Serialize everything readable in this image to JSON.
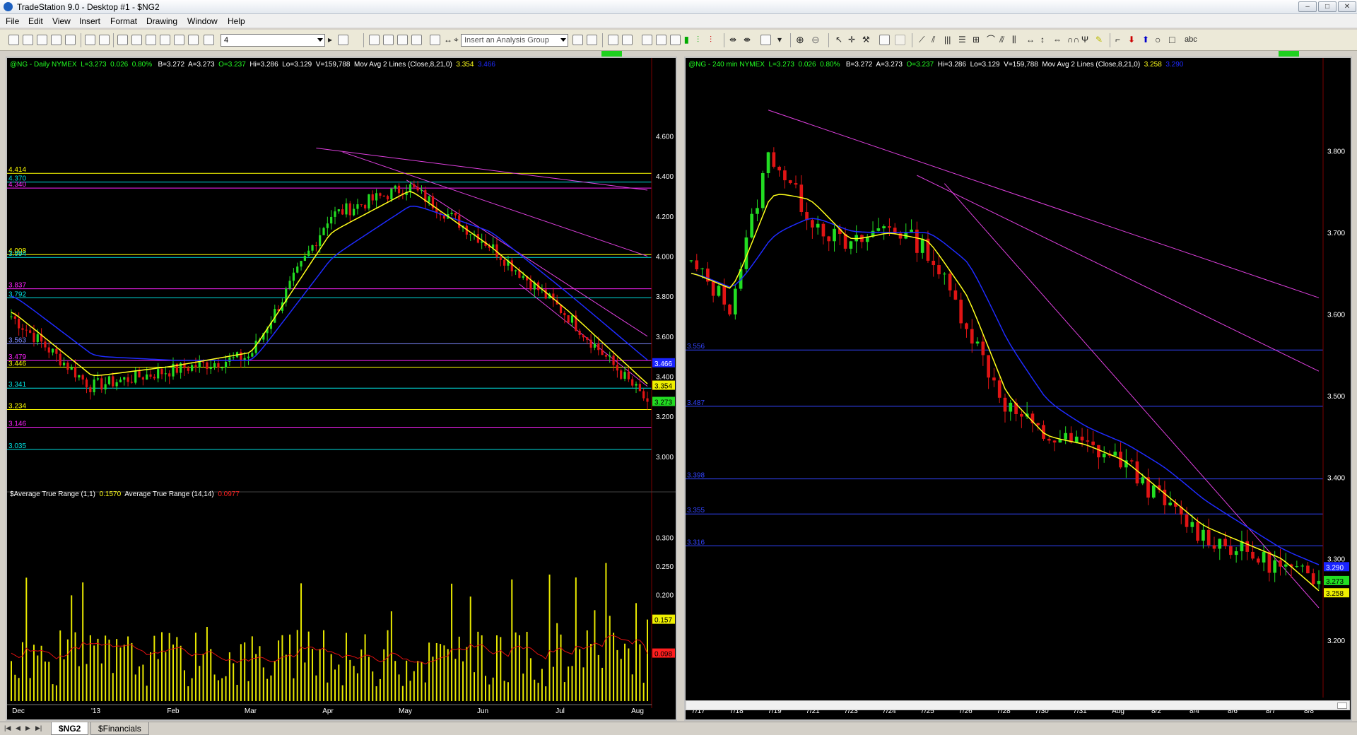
{
  "window": {
    "title": "TradeStation 9.0 - Desktop #1 - $NG2",
    "min": "–",
    "max": "□",
    "close": "✕"
  },
  "menu": [
    "File",
    "Edit",
    "View",
    "Insert",
    "Format",
    "Drawing",
    "Window",
    "Help"
  ],
  "toolbar": {
    "interval_value": "4",
    "analysis_group_placeholder": "Insert an Analysis Group",
    "text_tool": "abc"
  },
  "charts": [
    {
      "id": "daily",
      "header": {
        "symbol": "@NG - Daily  NYMEX",
        "last": "L=3.273",
        "chg": "0.026",
        "pct": "0.80%",
        "bid": "B=3.272",
        "ask": "A=3.273",
        "open": "O=3.237",
        "high": "Hi=3.286",
        "low": "Lo=3.129",
        "vol": "V=159,788",
        "study": "Mov Avg 2 Lines (Close,8,21,0)",
        "ma_fast": "3.354",
        "ma_slow": "3.466"
      },
      "price_axis": {
        "ticks": [
          "4.600",
          "4.400",
          "4.200",
          "4.000",
          "3.800",
          "3.600",
          "3.400",
          "3.200",
          "3.000"
        ],
        "range": [
          2.83,
          4.75
        ]
      },
      "price_markers": [
        {
          "label": "3.466",
          "color": "#1a24ff"
        },
        {
          "label": "3.354",
          "color": "#f0f000"
        },
        {
          "label": "3.273",
          "color": "#22dd22"
        }
      ],
      "levels": [
        {
          "label": "4.414",
          "color": "#ffff00"
        },
        {
          "label": "4.370",
          "color": "#00e0e0"
        },
        {
          "label": "4.340",
          "color": "#ff22ff"
        },
        {
          "label": "4.008",
          "color": "#ffff00"
        },
        {
          "label": "3.994",
          "color": "#00e0e0"
        },
        {
          "label": "3.837",
          "color": "#ff22ff"
        },
        {
          "label": "3.792",
          "color": "#00e0e0"
        },
        {
          "label": "3.563",
          "color": "#7b88ff"
        },
        {
          "label": "3.479",
          "color": "#ff22ff"
        },
        {
          "label": "3.446",
          "color": "#ffff00"
        },
        {
          "label": "3.341",
          "color": "#00e0e0"
        },
        {
          "label": "3.234",
          "color": "#ffff00"
        },
        {
          "label": "3.146",
          "color": "#ff22ff"
        },
        {
          "label": "3.035",
          "color": "#00e0e0"
        }
      ],
      "date_axis": [
        "Dec",
        "'13",
        "Feb",
        "Mar",
        "Apr",
        "May",
        "Jun",
        "Jul",
        "Aug"
      ],
      "atr": {
        "header": {
          "name1": "$Average True Range (1,1)",
          "val1": "0.1570",
          "name2": "Average True Range (14,14)",
          "val2": "0.0977"
        },
        "axis": [
          "0.300",
          "0.250",
          "0.200"
        ],
        "range": [
          0.015,
          0.335
        ],
        "markers": [
          {
            "label": "0.157",
            "color": "#f0f000"
          },
          {
            "label": "0.098",
            "color": "#ff1e1e"
          }
        ]
      }
    },
    {
      "id": "240min",
      "header": {
        "symbol": "@NG - 240 min  NYMEX",
        "last": "L=3.273",
        "chg": "0.026",
        "pct": "0.80%",
        "bid": "B=3.272",
        "ask": "A=3.273",
        "open": "O=3.237",
        "high": "Hi=3.286",
        "low": "Lo=3.129",
        "vol": "V=159,788",
        "study": "Mov Avg 2 Lines (Close,8,21,0)",
        "ma_fast": "3.258",
        "ma_slow": "3.290"
      },
      "price_axis": {
        "ticks": [
          "3.800",
          "3.700",
          "3.600",
          "3.500",
          "3.400",
          "3.300",
          "3.200"
        ],
        "range": [
          3.13,
          3.855
        ]
      },
      "price_markers": [
        {
          "label": "3.290",
          "color": "#1a24ff"
        },
        {
          "label": "3.273",
          "color": "#22dd22"
        },
        {
          "label": "3.258",
          "color": "#f0f000"
        }
      ],
      "levels": [
        {
          "label": "3.556",
          "color": "#3344ff"
        },
        {
          "label": "3.487",
          "color": "#3344ff"
        },
        {
          "label": "3.398",
          "color": "#3344ff"
        },
        {
          "label": "3.355",
          "color": "#3344ff"
        },
        {
          "label": "3.316",
          "color": "#3344ff"
        }
      ],
      "date_axis": [
        "7/17",
        "7/18",
        "7/19",
        "7/21",
        "7/23",
        "7/24",
        "7/25",
        "7/26",
        "7/28",
        "7/30",
        "7/31",
        "Aug",
        "8/2",
        "8/4",
        "8/6",
        "8/7",
        "8/8"
      ]
    }
  ],
  "tabs": {
    "nav": [
      "|◀",
      "◀",
      "▶",
      "▶|"
    ],
    "items": [
      "$NG2",
      "$Financials"
    ],
    "active": 0
  },
  "colors": {
    "up": "#22dd22",
    "down": "#e01414",
    "ma_fast": "#ffff1a",
    "ma_slow": "#1f2bff",
    "trend": "#e040e0",
    "atr_bar": "#e8e800",
    "atr_avg": "#e01010",
    "grid": "#ffffff"
  },
  "chart_data": [
    {
      "type": "candlestick",
      "title": "@NG - Daily",
      "x": [
        "Dec",
        "'13",
        "Feb",
        "Mar",
        "Apr",
        "May",
        "Jun",
        "Jul",
        "Aug"
      ],
      "series": [
        {
          "name": "Close",
          "values": [
            3.7,
            3.35,
            3.43,
            3.5,
            4.2,
            4.35,
            4.06,
            3.7,
            3.273
          ]
        },
        {
          "name": "Mov Avg (8)",
          "values": [
            3.72,
            3.4,
            3.45,
            3.52,
            4.12,
            4.33,
            4.05,
            3.72,
            3.354
          ]
        },
        {
          "name": "Mov Avg (21)",
          "values": [
            3.8,
            3.5,
            3.48,
            3.48,
            4.0,
            4.26,
            4.12,
            3.8,
            3.466
          ]
        }
      ],
      "ylim": [
        2.83,
        4.75
      ],
      "last": {
        "open": 3.237,
        "high": 3.286,
        "low": 3.129,
        "close": 3.273
      }
    },
    {
      "type": "bar",
      "title": "Average True Range",
      "series": [
        {
          "name": "$Average True Range (1,1)",
          "last": 0.157
        },
        {
          "name": "Average True Range (14,14)",
          "last": 0.0977
        }
      ],
      "ylim": [
        0.015,
        0.335
      ]
    },
    {
      "type": "candlestick",
      "title": "@NG - 240 min",
      "x": [
        "7/17",
        "7/18",
        "7/19",
        "7/21",
        "7/23",
        "7/24",
        "7/25",
        "7/26",
        "7/28",
        "7/30",
        "7/31",
        "Aug",
        "8/2",
        "8/4",
        "8/6",
        "8/7",
        "8/8"
      ],
      "series": [
        {
          "name": "Close",
          "values": [
            3.66,
            3.61,
            3.8,
            3.72,
            3.68,
            3.71,
            3.68,
            3.59,
            3.49,
            3.45,
            3.44,
            3.42,
            3.37,
            3.33,
            3.31,
            3.29,
            3.273
          ]
        },
        {
          "name": "Mov Avg (8)",
          "values": [
            3.65,
            3.63,
            3.75,
            3.74,
            3.69,
            3.7,
            3.69,
            3.62,
            3.5,
            3.45,
            3.44,
            3.42,
            3.38,
            3.34,
            3.32,
            3.3,
            3.258
          ]
        },
        {
          "name": "Mov Avg (21)",
          "values": [
            3.65,
            3.63,
            3.7,
            3.72,
            3.7,
            3.7,
            3.7,
            3.66,
            3.56,
            3.49,
            3.46,
            3.44,
            3.41,
            3.37,
            3.34,
            3.31,
            3.29
          ]
        }
      ],
      "ylim": [
        3.13,
        3.855
      ]
    }
  ]
}
